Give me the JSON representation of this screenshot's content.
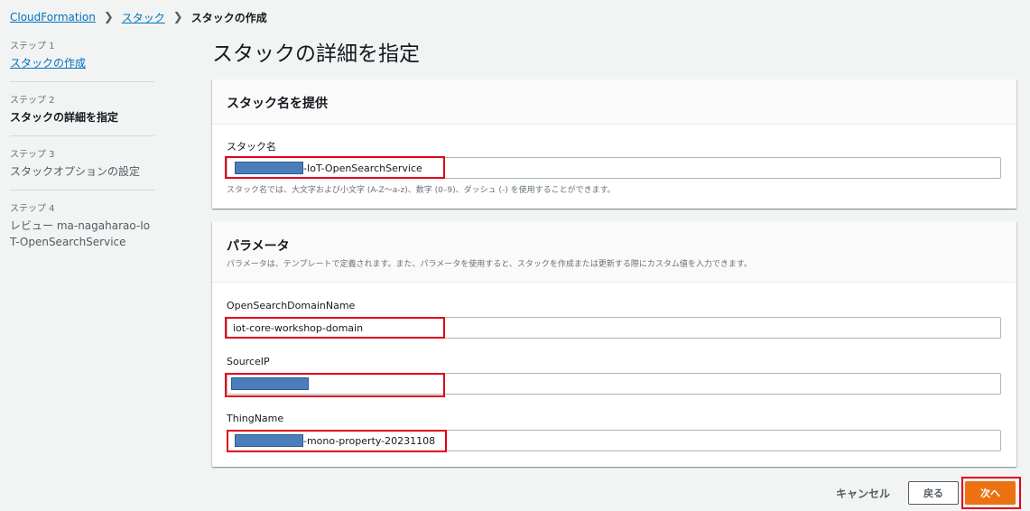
{
  "breadcrumb": {
    "root": "CloudFormation",
    "parent": "スタック",
    "current": "スタックの作成"
  },
  "sidebar": {
    "steps": [
      {
        "label": "ステップ 1",
        "title": "スタックの作成"
      },
      {
        "label": "ステップ 2",
        "title": "スタックの詳細を指定"
      },
      {
        "label": "ステップ 3",
        "title": "スタックオプションの設定"
      },
      {
        "label": "ステップ 4",
        "title": "レビュー ma-nagaharao-IoT-OpenSearchService"
      }
    ]
  },
  "page": {
    "title": "スタックの詳細を指定"
  },
  "stack_name_panel": {
    "title": "スタック名を提供",
    "field_label": "スタック名",
    "value_suffix": "-IoT-OpenSearchService",
    "constraint": "スタック名では、大文字および小文字 (A-Z～a-z)、数字 (0–9)、ダッシュ (-) を使用することができます。"
  },
  "parameters_panel": {
    "title": "パラメータ",
    "description": "パラメータは、テンプレートで定義されます。また、パラメータを使用すると、スタックを作成または更新する際にカスタム値を入力できます。",
    "fields": [
      {
        "label": "OpenSearchDomainName",
        "value": "iot-core-workshop-domain"
      },
      {
        "label": "SourceIP",
        "value": ""
      },
      {
        "label": "ThingName",
        "value_suffix": "-mono-property-20231108"
      }
    ]
  },
  "actions": {
    "cancel": "キャンセル",
    "back": "戻る",
    "next": "次へ"
  },
  "colors": {
    "link": "#0073bb",
    "primary": "#ec7211",
    "highlight": "#e0001b",
    "redaction": "#4a7ebb",
    "background": "#f2f3f3"
  }
}
